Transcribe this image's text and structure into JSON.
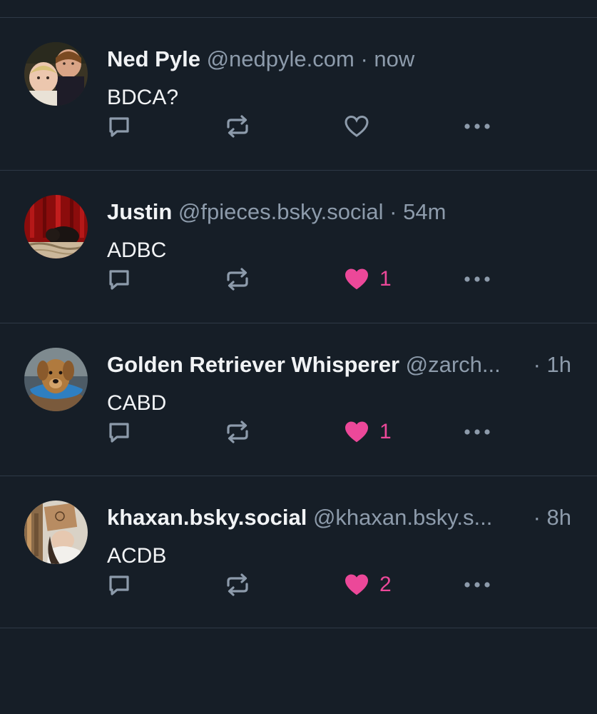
{
  "posts": [
    {
      "display_name": "Ned Pyle",
      "handle": "@nedpyle.com",
      "separator": "·",
      "time": "now",
      "text": "BDCA?",
      "liked": false,
      "like_count": "",
      "avatar": "two-children-photo"
    },
    {
      "display_name": "Justin",
      "handle": "@fpieces.bsky.social",
      "separator": "·",
      "time": "54m",
      "text": "ADBC",
      "liked": true,
      "like_count": "1",
      "avatar": "dog-red-curtain-photo"
    },
    {
      "display_name": "Golden Retriever Whisperer",
      "handle": "@zarch...",
      "separator": "·",
      "time": "1h",
      "text": "CABD",
      "liked": true,
      "like_count": "1",
      "avatar": "golden-retriever-cone-photo"
    },
    {
      "display_name": "khaxan.bsky.social",
      "handle": "@khaxan.bsky.s...",
      "separator": "·",
      "time": "8h",
      "text": "ACDB",
      "liked": true,
      "like_count": "2",
      "avatar": "person-box-mask-photo"
    }
  ],
  "icons": {
    "reply": "reply-icon",
    "repost": "repost-icon",
    "like": "heart-icon",
    "more": "more-options-icon"
  },
  "colors": {
    "background": "#161e27",
    "divider": "#2e3946",
    "icon_gray": "#8d9bab",
    "like_pink": "#ec4899",
    "text": "#f1f3f5"
  }
}
